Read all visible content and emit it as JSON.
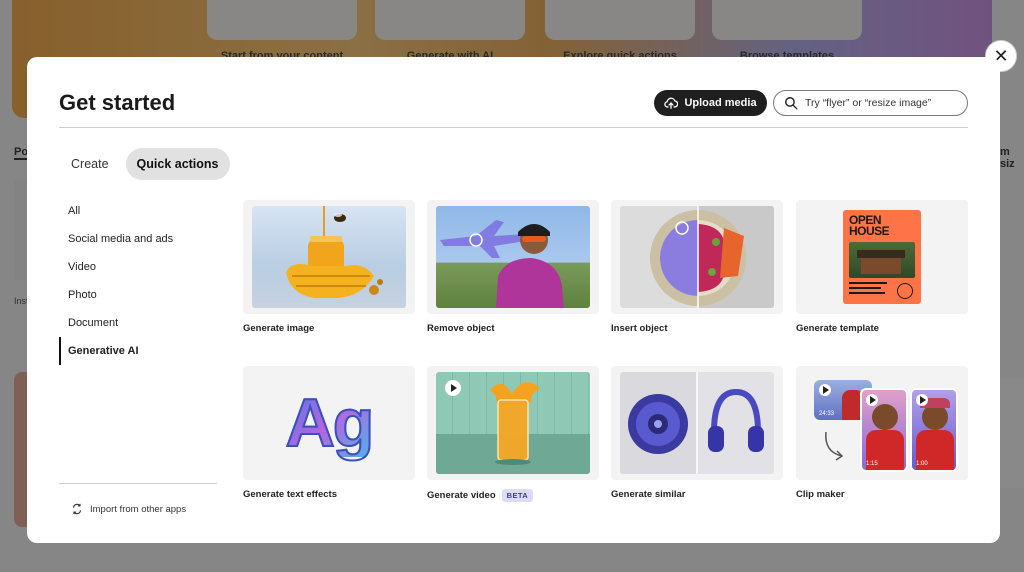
{
  "background": {
    "cards": [
      "Start from your content",
      "Generate with AI",
      "Explore quick actions",
      "Browse templates"
    ],
    "tab": "Po",
    "right_text": "m siz",
    "small_text": "Inst"
  },
  "dialog": {
    "title": "Get started",
    "upload_label": "Upload media",
    "search_placeholder": "Try “flyer” or “resize image”",
    "tabs": [
      {
        "label": "Create",
        "active": false
      },
      {
        "label": "Quick actions",
        "active": true
      }
    ],
    "sidebar": [
      {
        "label": "All"
      },
      {
        "label": "Social media and ads"
      },
      {
        "label": "Video"
      },
      {
        "label": "Photo"
      },
      {
        "label": "Document"
      },
      {
        "label": "Generative AI",
        "active": true
      }
    ],
    "import_label": "Import from other apps",
    "cards": [
      {
        "label": "Generate image"
      },
      {
        "label": "Remove object"
      },
      {
        "label": "Insert object"
      },
      {
        "label": "Generate template",
        "poster_text": "OPEN HOUSE"
      },
      {
        "label": "Generate text effects",
        "sample_text": "Ag"
      },
      {
        "label": "Generate video",
        "badge": "BETA"
      },
      {
        "label": "Generate similar"
      },
      {
        "label": "Clip maker",
        "timestamps": [
          "24:33",
          "1:15",
          "1:00"
        ]
      }
    ]
  },
  "colors": {
    "accent_dark": "#1f1f1f",
    "tab_active_bg": "#e1e1e1",
    "beta_bg": "#dcdcf7"
  }
}
